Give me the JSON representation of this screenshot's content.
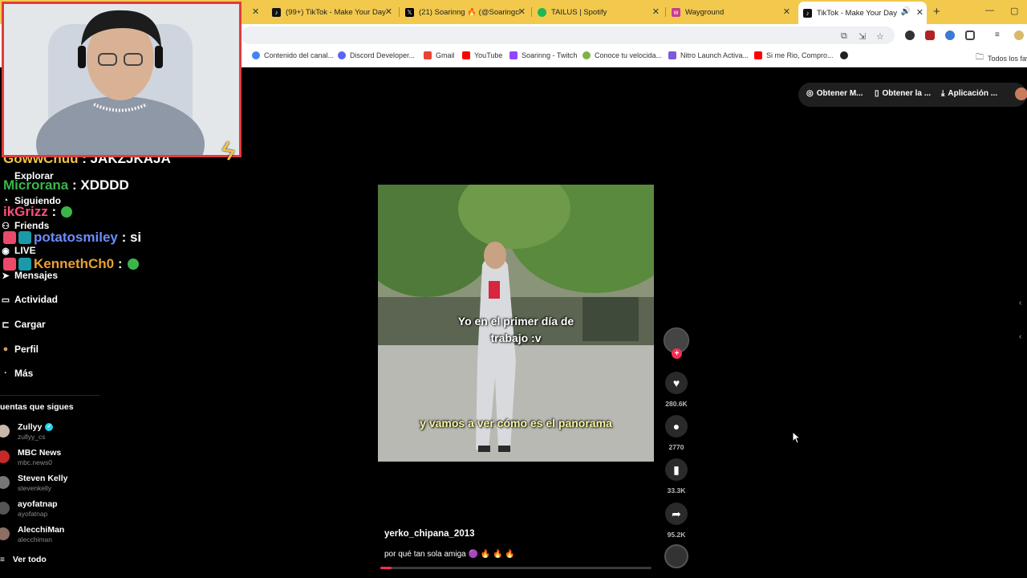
{
  "browser": {
    "tabs": [
      {
        "label": "(99+) TikTok - Make Your Day",
        "icon": "tiktok-icon",
        "color": "#111111"
      },
      {
        "label": "(21) Soarinng 🔥 (@Soaringch",
        "icon": "x-icon",
        "color": "#000000"
      },
      {
        "label": "TAILUS | Spotify",
        "icon": "spotify-icon",
        "color": "#1db954"
      },
      {
        "label": "Wayground",
        "icon": "wayground-icon",
        "color": "#c93c8e"
      },
      {
        "label": "TikTok - Make Your Day",
        "icon": "tiktok-icon",
        "color": "#111111"
      }
    ],
    "bookmarks": [
      {
        "label": "Contenido del canal...",
        "icon": "google-icon",
        "color": "#4285f4"
      },
      {
        "label": "Discord Developer...",
        "icon": "discord-icon",
        "color": "#5865f2"
      },
      {
        "label": "Gmail",
        "icon": "gmail-icon",
        "color": "#ea4335"
      },
      {
        "label": "YouTube",
        "icon": "youtube-icon",
        "color": "#ff0000"
      },
      {
        "label": "Soarinng - Twitch",
        "icon": "twitch-icon",
        "color": "#9146ff"
      },
      {
        "label": "Conoce tu velocida...",
        "icon": "speed-icon",
        "color": "#7cb342"
      },
      {
        "label": "Nitro Launch Activa...",
        "icon": "nitro-icon",
        "color": "#7b5cd6"
      },
      {
        "label": "Si me Rio, Compro...",
        "icon": "youtube-icon",
        "color": "#ff0000"
      }
    ],
    "all_bookmarks": "Todos los fav"
  },
  "chat": [
    {
      "user": "GowwChuu",
      "message": ": JAKZJKAJA",
      "color": "#f4c542",
      "badges": 0
    },
    {
      "user": "Microrana",
      "message": ": XDDDD",
      "color": "#3bb54a",
      "badges": 0
    },
    {
      "user": "ikGrizz",
      "message": ":",
      "color": "#ff4f7a",
      "badges": 0,
      "emote": true
    },
    {
      "user": "potatosmiley",
      "message": ": si",
      "color": "#6c8cff",
      "badges": 2
    },
    {
      "user": "KennethCh0",
      "message": ":",
      "color": "#e8a033",
      "badges": 2,
      "emote": true
    }
  ],
  "sidebar": {
    "nav": [
      {
        "label": "Explorar",
        "icon": "compass-icon"
      },
      {
        "label": "Siguiendo",
        "icon": "following-icon"
      },
      {
        "label": "Friends",
        "icon": "friends-icon"
      },
      {
        "label": "LIVE",
        "icon": "live-icon"
      },
      {
        "label": "Mensajes",
        "icon": "messages-icon"
      },
      {
        "label": "Actividad",
        "icon": "activity-icon"
      },
      {
        "label": "Cargar",
        "icon": "upload-icon"
      },
      {
        "label": "Perfil",
        "icon": "profile-icon"
      },
      {
        "label": "Más",
        "icon": "more-icon"
      }
    ],
    "following_title": "uentas que sigues",
    "accounts": [
      {
        "name": "Zullyy",
        "handle": "zullyy_cs",
        "verified": true
      },
      {
        "name": "MBC News",
        "handle": "mbc.news0",
        "verified": false
      },
      {
        "name": "Steven Kelly",
        "handle": "stevenkelly",
        "verified": false
      },
      {
        "name": "ayofatnap",
        "handle": "ayofatnap",
        "verified": false
      },
      {
        "name": "AlecchiMan",
        "handle": "alecchiman",
        "verified": false
      }
    ],
    "see_all": "Ver todo"
  },
  "header": {
    "buttons": [
      {
        "label": "Obtener M...",
        "icon": "coin-icon"
      },
      {
        "label": "Obtener la ...",
        "icon": "phone-icon"
      },
      {
        "label": "Aplicación ...",
        "icon": "download-icon"
      }
    ]
  },
  "video": {
    "caption_top": "Yo en el primer día de trabajo :v",
    "caption_bottom": "y vamos a ver cómo es el panorama",
    "author": "yerko_chipana_2013",
    "description": "por qué tan sola amiga 🟣 🔥 🔥 🔥",
    "progress": 0.04
  },
  "actions": {
    "likes": "280.6K",
    "comments": "2770",
    "saves": "33.3K",
    "shares": "95.2K"
  }
}
